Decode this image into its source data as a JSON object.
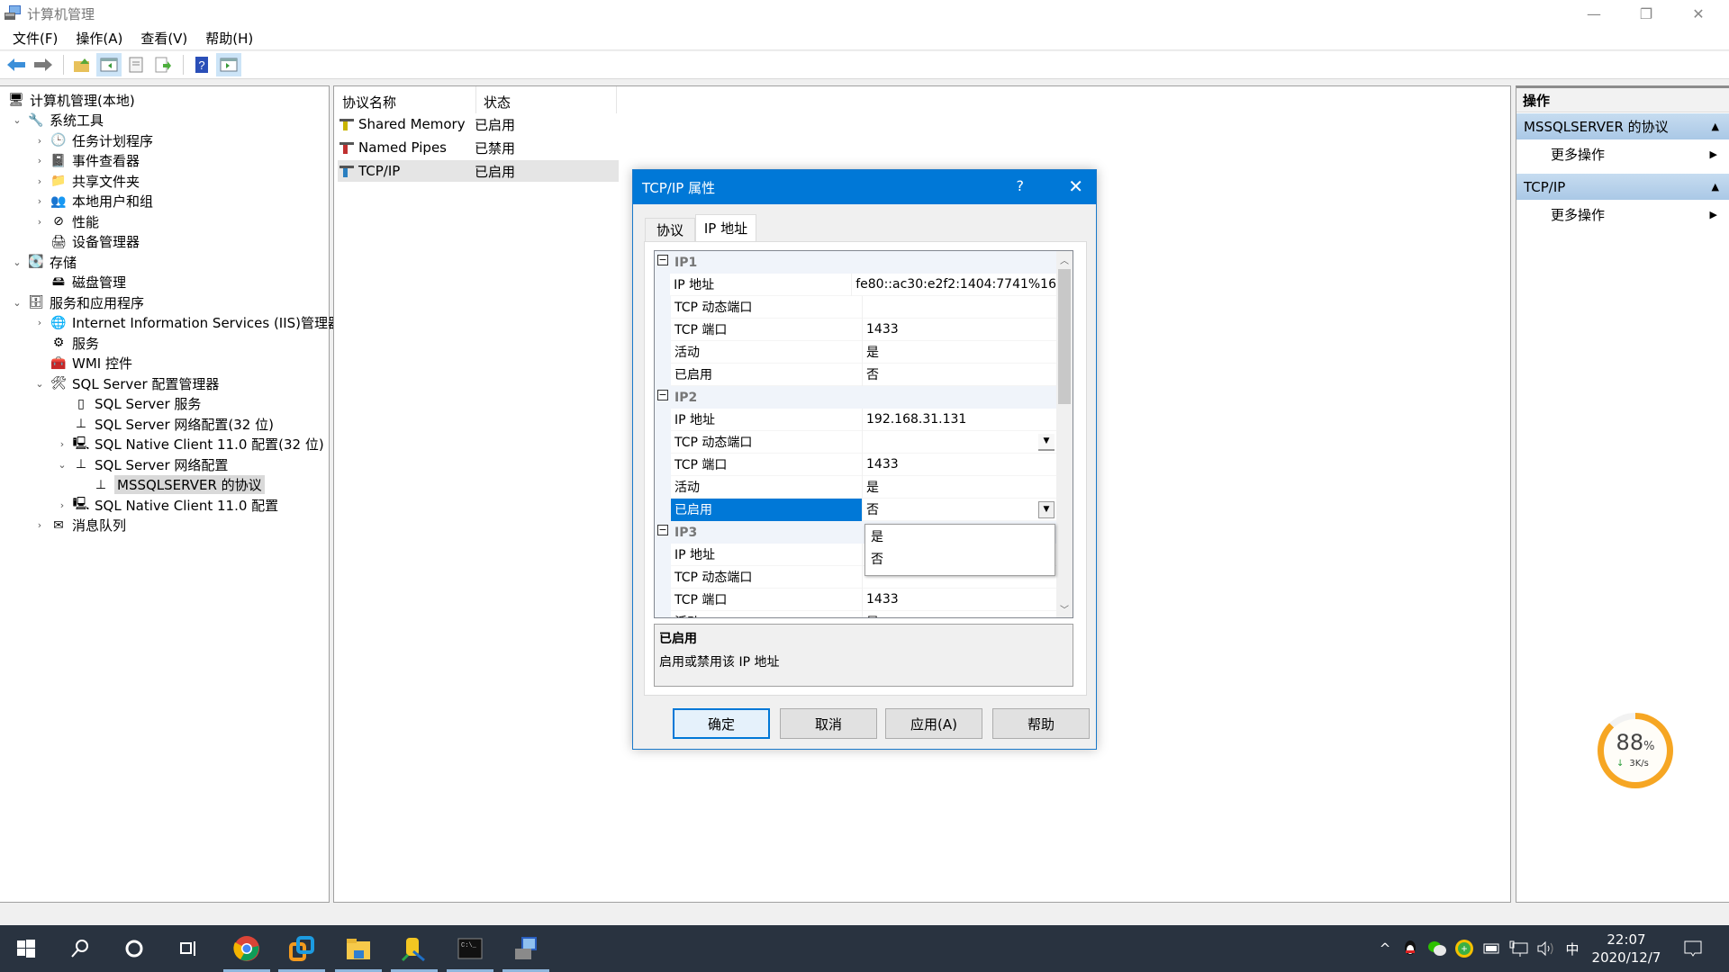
{
  "window": {
    "title": "计算机管理",
    "controls": {
      "minimize": "—",
      "restore": "❐",
      "close": "✕"
    }
  },
  "menu": [
    "文件(F)",
    "操作(A)",
    "查看(V)",
    "帮助(H)"
  ],
  "toolbar": {
    "buttons": [
      {
        "name": "back-icon",
        "glyph": "⬅"
      },
      {
        "name": "forward-icon",
        "glyph": "➡"
      },
      {
        "name": "up-folder-icon",
        "glyph": "📂"
      },
      {
        "name": "show-hide-console-tree-icon",
        "glyph": "▤"
      },
      {
        "name": "properties-icon",
        "glyph": "▦"
      },
      {
        "name": "export-list-icon",
        "glyph": "⇨"
      },
      {
        "name": "help-icon",
        "glyph": "?"
      },
      {
        "name": "show-hide-action-pane-icon",
        "glyph": "▥"
      }
    ]
  },
  "tree": {
    "items": [
      {
        "label": "计算机管理(本地)",
        "level": 0,
        "chevron": "",
        "icon": "computer-management-icon",
        "glyph": "🖥"
      },
      {
        "label": "系统工具",
        "level": 1,
        "chevron": "⌄",
        "icon": "system-tools-icon",
        "glyph": "🔧"
      },
      {
        "label": "任务计划程序",
        "level": 2,
        "chevron": "›",
        "icon": "task-scheduler-icon",
        "glyph": "🕒"
      },
      {
        "label": "事件查看器",
        "level": 2,
        "chevron": "›",
        "icon": "event-viewer-icon",
        "glyph": "📓"
      },
      {
        "label": "共享文件夹",
        "level": 2,
        "chevron": "›",
        "icon": "shared-folders-icon",
        "glyph": "📁"
      },
      {
        "label": "本地用户和组",
        "level": 2,
        "chevron": "›",
        "icon": "local-users-groups-icon",
        "glyph": "👥"
      },
      {
        "label": "性能",
        "level": 2,
        "chevron": "›",
        "icon": "performance-icon",
        "glyph": "⊘"
      },
      {
        "label": "设备管理器",
        "level": 2,
        "chevron": "",
        "icon": "device-manager-icon",
        "glyph": "🖨"
      },
      {
        "label": "存储",
        "level": 1,
        "chevron": "⌄",
        "icon": "storage-icon",
        "glyph": "💽"
      },
      {
        "label": "磁盘管理",
        "level": 2,
        "chevron": "",
        "icon": "disk-management-icon",
        "glyph": "🖴"
      },
      {
        "label": "服务和应用程序",
        "level": 1,
        "chevron": "⌄",
        "icon": "services-applications-icon",
        "glyph": "🗄"
      },
      {
        "label": "Internet Information Services (IIS)管理器",
        "level": 2,
        "chevron": "›",
        "icon": "iis-manager-icon",
        "glyph": "🌐"
      },
      {
        "label": "服务",
        "level": 2,
        "chevron": "",
        "icon": "services-icon",
        "glyph": "⚙"
      },
      {
        "label": "WMI 控件",
        "level": 2,
        "chevron": "",
        "icon": "wmi-control-icon",
        "glyph": "🧰"
      },
      {
        "label": "SQL Server 配置管理器",
        "level": 2,
        "chevron": "⌄",
        "icon": "sql-config-manager-icon",
        "glyph": "🛠"
      },
      {
        "label": "SQL Server 服务",
        "level": 3,
        "chevron": "",
        "icon": "sql-server-services-icon",
        "glyph": "▯"
      },
      {
        "label": "SQL Server 网络配置(32 位)",
        "level": 3,
        "chevron": "",
        "icon": "sql-network-config-32-icon",
        "glyph": "⊥"
      },
      {
        "label": "SQL Native Client 11.0 配置(32 位)",
        "level": 3,
        "chevron": "›",
        "icon": "sql-native-client-32-icon",
        "glyph": "🖳"
      },
      {
        "label": "SQL Server 网络配置",
        "level": 3,
        "chevron": "⌄",
        "icon": "sql-network-config-icon",
        "glyph": "⊥"
      },
      {
        "label": "MSSQLSERVER 的协议",
        "level": 4,
        "chevron": "",
        "icon": "mssqlserver-protocols-icon",
        "glyph": "⊥",
        "selected": true
      },
      {
        "label": "SQL Native Client 11.0 配置",
        "level": 3,
        "chevron": "›",
        "icon": "sql-native-client-icon",
        "glyph": "🖳"
      },
      {
        "label": "消息队列",
        "level": 2,
        "chevron": "›",
        "icon": "message-queuing-icon",
        "glyph": "✉"
      }
    ]
  },
  "list": {
    "headers": [
      "协议名称",
      "状态"
    ],
    "rows": [
      {
        "name": "Shared Memory",
        "state": "已启用",
        "icon_color": "#c8b400"
      },
      {
        "name": "Named Pipes",
        "state": "已禁用",
        "icon_color": "#c03030"
      },
      {
        "name": "TCP/IP",
        "state": "已启用",
        "icon_color": "#2a7fc0",
        "highlighted": true
      }
    ]
  },
  "actions": {
    "title": "操作",
    "groups": [
      {
        "label": "MSSQLSERVER 的协议",
        "items": [
          "更多操作"
        ]
      },
      {
        "label": "TCP/IP",
        "items": [
          "更多操作"
        ]
      }
    ]
  },
  "dialog": {
    "title": "TCP/IP 属性",
    "help": "?",
    "close": "✕",
    "tabs": [
      {
        "label": "协议",
        "active": false
      },
      {
        "label": "IP 地址",
        "active": true
      }
    ],
    "categories": [
      {
        "name": "IP1",
        "rows": [
          {
            "prop": "IP 地址",
            "value": "fe80::ac30:e2f2:1404:7741%16"
          },
          {
            "prop": "TCP 动态端口",
            "value": ""
          },
          {
            "prop": "TCP 端口",
            "value": "1433"
          },
          {
            "prop": "活动",
            "value": "是"
          },
          {
            "prop": "已启用",
            "value": "否"
          }
        ]
      },
      {
        "name": "IP2",
        "rows": [
          {
            "prop": "IP 地址",
            "value": "192.168.31.131"
          },
          {
            "prop": "TCP 动态端口",
            "value": ""
          },
          {
            "prop": "TCP 端口",
            "value": "1433"
          },
          {
            "prop": "活动",
            "value": "是"
          },
          {
            "prop": "已启用",
            "value": "否",
            "selected": true
          }
        ]
      },
      {
        "name": "IP3",
        "rows": [
          {
            "prop": "IP 地址",
            "value": ""
          },
          {
            "prop": "TCP 动态端口",
            "value": ""
          },
          {
            "prop": "TCP 端口",
            "value": "1433"
          },
          {
            "prop": "活动",
            "value": "是"
          }
        ]
      }
    ],
    "dropdown_options": [
      "是",
      "否"
    ],
    "description": {
      "title": "已启用",
      "text": "启用或禁用该 IP 地址"
    },
    "buttons": {
      "ok": "确定",
      "cancel": "取消",
      "apply": "应用(A)",
      "help": "帮助"
    }
  },
  "speed_widget": {
    "percent": 88,
    "percent_label": "88",
    "percent_sign": "%",
    "rate": "3K/s",
    "accent": "#f6a623"
  },
  "taskbar": {
    "apps": [
      "start-button",
      "search-button",
      "cortana-button",
      "task-view-button",
      "chrome-app",
      "vmware-app",
      "file-explorer-app",
      "sql-config-app",
      "cmd-app",
      "computer-management-app"
    ],
    "tray": {
      "chevron": "^",
      "ime": "中",
      "time": "22:07",
      "date": "2020/12/7"
    }
  }
}
